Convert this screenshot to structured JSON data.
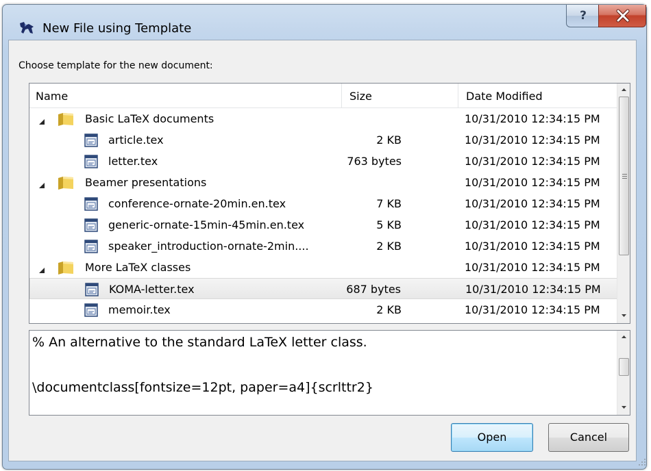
{
  "window": {
    "title": "New File using Template",
    "help_glyph": "?",
    "icons": {
      "app": "texworks-lion-icon",
      "help": "help-icon",
      "close": "close-icon"
    }
  },
  "prompt": "Choose template for the new document:",
  "list": {
    "columns": {
      "name": "Name",
      "size": "Size",
      "date": "Date Modified"
    },
    "rows": [
      {
        "type": "folder",
        "name": "Basic LaTeX documents",
        "size": "",
        "date": "10/31/2010 12:34:15 PM"
      },
      {
        "type": "file",
        "name": "article.tex",
        "size": "2 KB",
        "date": "10/31/2010 12:34:15 PM"
      },
      {
        "type": "file",
        "name": "letter.tex",
        "size": "763 bytes",
        "date": "10/31/2010 12:34:15 PM"
      },
      {
        "type": "folder",
        "name": "Beamer presentations",
        "size": "",
        "date": "10/31/2010 12:34:15 PM"
      },
      {
        "type": "file",
        "name": "conference-ornate-20min.en.tex",
        "size": "7 KB",
        "date": "10/31/2010 12:34:15 PM"
      },
      {
        "type": "file",
        "name": "generic-ornate-15min-45min.en.tex",
        "size": "5 KB",
        "date": "10/31/2010 12:34:15 PM"
      },
      {
        "type": "file",
        "name": "speaker_introduction-ornate-2min....",
        "size": "2 KB",
        "date": "10/31/2010 12:34:15 PM"
      },
      {
        "type": "folder",
        "name": "More LaTeX classes",
        "size": "",
        "date": "10/31/2010 12:34:15 PM"
      },
      {
        "type": "file",
        "name": "KOMA-letter.tex",
        "size": "687 bytes",
        "date": "10/31/2010 12:34:15 PM",
        "selected": true
      },
      {
        "type": "file",
        "name": "memoir.tex",
        "size": "2 KB",
        "date": "10/31/2010 12:34:15 PM"
      }
    ]
  },
  "preview": {
    "lines": [
      "% An alternative to the standard LaTeX letter class.",
      "",
      "\\documentclass[fontsize=12pt, paper=a4]{scrlttr2}"
    ]
  },
  "buttons": {
    "open": "Open",
    "cancel": "Cancel"
  },
  "colors": {
    "titlebar": "#c3d6ec",
    "close_button": "#c2422b",
    "default_button_border": "#3c7fb1",
    "selection": "#e8e8e8"
  }
}
